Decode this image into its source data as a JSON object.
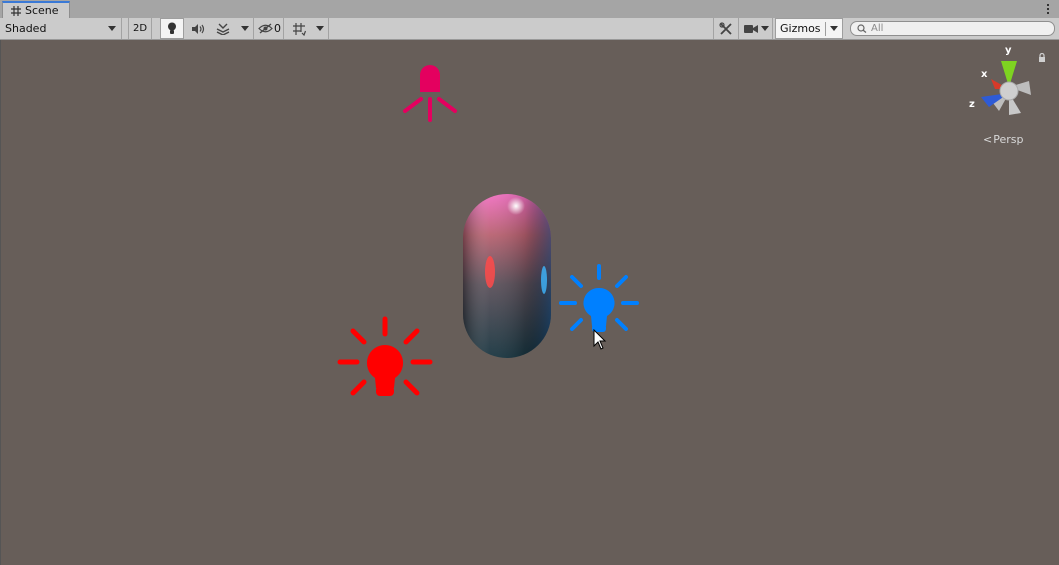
{
  "tab": {
    "title": "Scene",
    "icon": "grid-hash-icon"
  },
  "toolbar": {
    "shading_mode": "Shaded",
    "mode_2d": "2D",
    "hidden_count": "0",
    "gizmos": "Gizmos",
    "icons": [
      "lighting-bulb-icon",
      "audio-speaker-icon",
      "effects-layers-icon",
      "hidden-objects-eye-icon",
      "grid-icon",
      "tools-icon",
      "camera-icon"
    ]
  },
  "search": {
    "placeholder": "All",
    "value": ""
  },
  "viewport": {
    "projection_label": "Persp",
    "gizmo_axes": {
      "x": "x",
      "y": "y",
      "z": "z"
    },
    "background_color": "#675e59",
    "objects": [
      {
        "name": "Directional Light",
        "icon": "directional-light-icon",
        "color": "#e4005f"
      },
      {
        "name": "Red Point Light",
        "icon": "point-light-bulb-icon",
        "color": "#ff0000"
      },
      {
        "name": "Blue Point Light",
        "icon": "point-light-bulb-icon",
        "color": "#0080ff"
      },
      {
        "name": "Capsule",
        "icon": "capsule-mesh"
      }
    ]
  },
  "colors": {
    "tab_accent": "#3a79d6",
    "axis_x": "#d63a2a",
    "axis_y": "#7ed321",
    "axis_z": "#2e5bd6"
  }
}
